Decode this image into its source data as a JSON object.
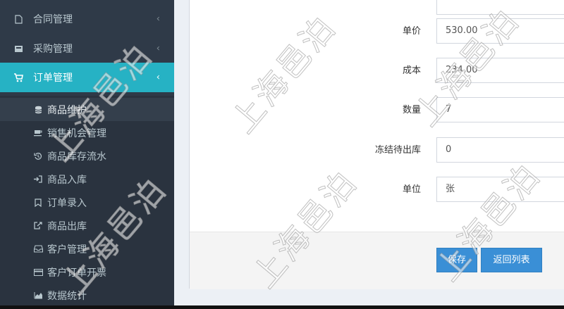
{
  "sidebar": {
    "menus": [
      {
        "label": "合同管理",
        "icon": "file-icon"
      },
      {
        "label": "采购管理",
        "icon": "inbox-icon"
      },
      {
        "label": "订单管理",
        "icon": "cart-icon",
        "active": true
      }
    ],
    "sub_items": [
      {
        "label": "商品维护",
        "icon": "database-icon",
        "selected": true
      },
      {
        "label": "销售机会管理",
        "icon": "coffee-icon"
      },
      {
        "label": "商品库存流水",
        "icon": "history-icon"
      },
      {
        "label": "商品入库",
        "icon": "sign-in-icon"
      },
      {
        "label": "订单录入",
        "icon": "bookmark-icon"
      },
      {
        "label": "商品出库",
        "icon": "share-icon"
      },
      {
        "label": "客户管理",
        "icon": "inbox-icon"
      },
      {
        "label": "客户订单开票",
        "icon": "credit-card-icon"
      },
      {
        "label": "数据统计",
        "icon": "area-chart-icon"
      }
    ]
  },
  "form": {
    "fields": [
      {
        "label": "单价",
        "value": "530.00"
      },
      {
        "label": "成本",
        "value": "234.00"
      },
      {
        "label": "数量",
        "value": "7"
      },
      {
        "label": "冻结待出库",
        "value": "0"
      },
      {
        "label": "单位",
        "value": "张"
      }
    ],
    "save_label": "保存",
    "back_label": "返回列表"
  },
  "watermark": "上海邑泊",
  "colors": {
    "sidebar": "#2f3a48",
    "active": "#26b2c4",
    "button": "#3a8fd6"
  }
}
